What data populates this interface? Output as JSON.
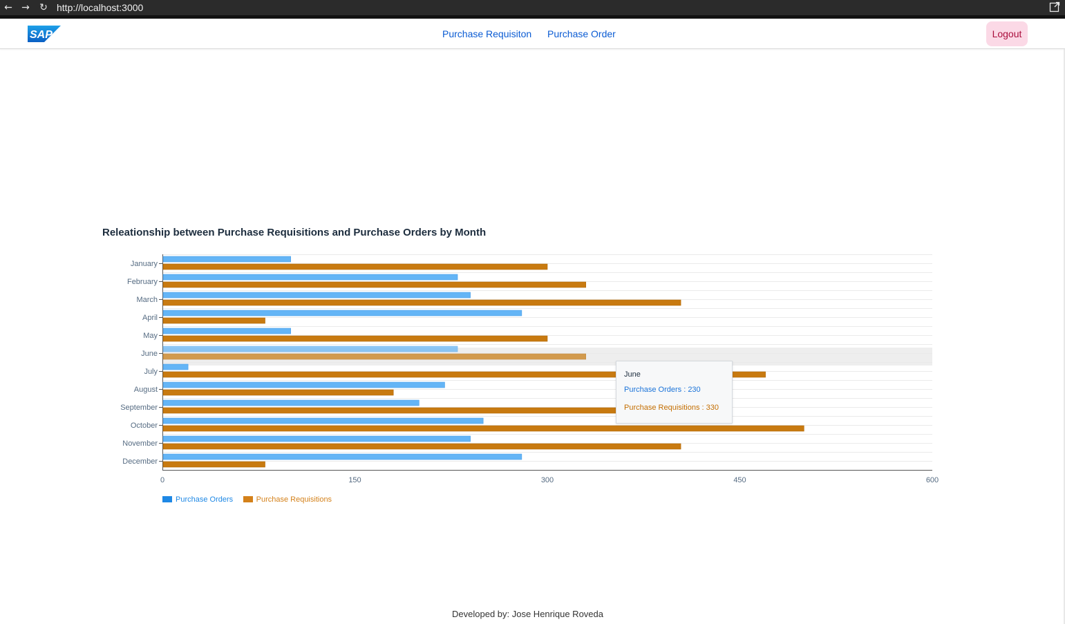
{
  "browser": {
    "url": "http://localhost:3000",
    "back_icon": "←",
    "forward_icon": "→",
    "reload_icon": "↻",
    "popout_icon": "⧉"
  },
  "header": {
    "logo_text": "SAP",
    "nav": [
      {
        "label": "Purchase Requisiton"
      },
      {
        "label": "Purchase Order"
      }
    ],
    "logout_label": "Logout"
  },
  "colors": {
    "purchase_orders": "#64b5f6",
    "purchase_requisitions": "#c87a10",
    "legend_orders": "#1e88e5",
    "legend_requisitions": "#d4811a",
    "tooltip_orders_text": "#1a73d9",
    "tooltip_requisitions_text": "#c46e00",
    "logo_blue": "#0a6ed1"
  },
  "chart_data": {
    "type": "bar",
    "orientation": "horizontal",
    "title": "Releationship between Purchase Requisitions and Purchase Orders by Month",
    "categories": [
      "January",
      "February",
      "March",
      "April",
      "May",
      "June",
      "July",
      "August",
      "September",
      "October",
      "November",
      "December"
    ],
    "series": [
      {
        "name": "Purchase Orders",
        "values": [
          100,
          230,
          240,
          280,
          100,
          230,
          20,
          220,
          200,
          250,
          240,
          280
        ]
      },
      {
        "name": "Purchase Requisitions",
        "values": [
          300,
          330,
          404,
          80,
          300,
          330,
          470,
          180,
          360,
          500,
          404,
          80
        ]
      }
    ],
    "xlim": [
      0,
      600
    ],
    "xticks": [
      "0",
      "150",
      "300",
      "450",
      "600"
    ],
    "grid": true,
    "legend": "bottom-left",
    "highlighted_category": "June"
  },
  "tooltip": {
    "title": "June",
    "orders_line": "Purchase Orders : 230",
    "requisitions_line": "Purchase Requisitions : 330"
  },
  "footer": {
    "text": "Developed by: Jose Henrique Roveda"
  }
}
